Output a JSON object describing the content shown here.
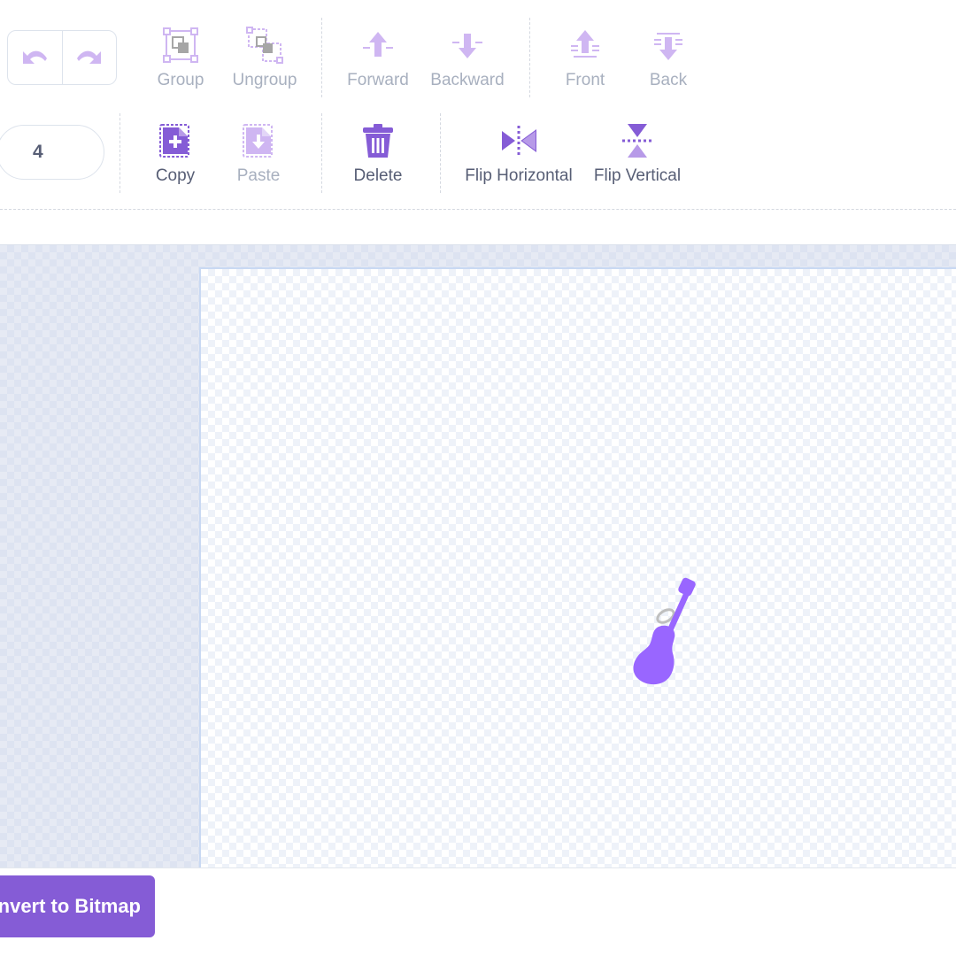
{
  "toolbar": {
    "row1": {
      "group_label": "Group",
      "ungroup_label": "Ungroup",
      "forward_label": "Forward",
      "backward_label": "Backward",
      "front_label": "Front",
      "back_label": "Back"
    },
    "row2": {
      "number_value": "4",
      "copy_label": "Copy",
      "paste_label": "Paste",
      "delete_label": "Delete",
      "flip_horizontal_label": "Flip Horizontal",
      "flip_vertical_label": "Flip Vertical"
    }
  },
  "footer": {
    "convert_label": "Convert to Bitmap"
  },
  "colors": {
    "accent": "#855cd6",
    "accent_light": "#cfb6f2",
    "text": "#575e75",
    "disabled_text": "#a8b0bf"
  },
  "icons": [
    "undo-icon",
    "redo-icon",
    "group-icon",
    "ungroup-icon",
    "forward-icon",
    "backward-icon",
    "front-icon",
    "back-icon",
    "copy-icon",
    "paste-icon",
    "delete-icon",
    "flip-horizontal-icon",
    "flip-vertical-icon",
    "guitar-icon"
  ]
}
